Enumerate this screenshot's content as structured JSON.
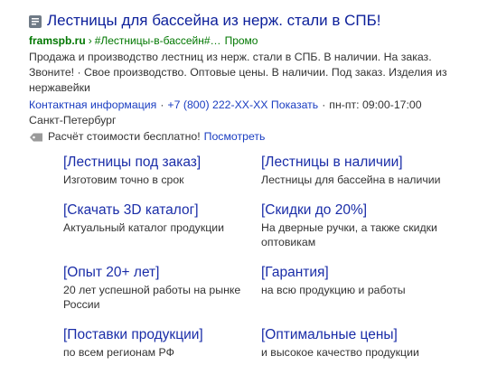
{
  "ad": {
    "favicon_icon": "site-favicon-icon",
    "title": "Лестницы для бассейна из нерж. стали в СПБ!",
    "domain": "framspb.ru",
    "separator": "›",
    "path": "#Лестницы-в-бассейн#…",
    "promo_label": "Промо",
    "description": "Продажа и производство лестниц из нерж. стали в СПБ. В наличии. На заказ. Звоните! · Свое производство. Оптовые цены. В наличии. Под заказ. Изделия из нержавейки",
    "contact_info": "Контактная информация",
    "phone": "+7 (800) 222-XX-XX Показать",
    "hours": "пн-пт: 09:00-17:00",
    "city": "Санкт-Петербург",
    "promo_icon": "tag-icon",
    "promo_text": "Расчёт стоимости бесплатно!",
    "promo_link": "Посмотреть"
  },
  "sitelinks": [
    {
      "title": "[Лестницы под заказ]",
      "desc": "Изготовим точно в срок"
    },
    {
      "title": "[Лестницы в наличии]",
      "desc": "Лестницы для бассейна в наличии"
    },
    {
      "title": "[Скачать 3D каталог]",
      "desc": "Актуальный каталог продукции"
    },
    {
      "title": "[Скидки до 20%]",
      "desc": "На дверные ручки, а также скидки оптовикам"
    },
    {
      "title": "[Опыт 20+ лет]",
      "desc": "20 лет успешной работы на рынке России"
    },
    {
      "title": "[Гарантия]",
      "desc": "на всю продукцию и работы"
    },
    {
      "title": "[Поставки продукции]",
      "desc": "по всем регионам РФ"
    },
    {
      "title": "[Оптимальные цены]",
      "desc": "и высокое качество продукции"
    }
  ]
}
